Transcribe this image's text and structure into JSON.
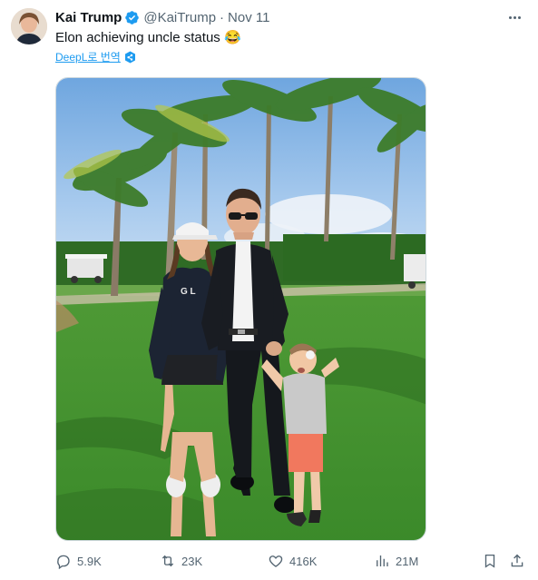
{
  "tweet": {
    "author_name": "Kai Trump",
    "handle": "@KaiTrump",
    "separator": "·",
    "time": "Nov 11",
    "text": "Elon achieving uncle status 😂",
    "translate_label": "DeepL로 번역",
    "actions": {
      "replies": "5.9K",
      "retweets": "23K",
      "likes": "416K",
      "views": "21M"
    }
  },
  "photo_shirt_text": "G  L",
  "colors": {
    "accent": "#1d9bf0",
    "text_secondary": "#536471",
    "verified": "#1d9bf0"
  },
  "icons": [
    "more-icon",
    "verified-badge-icon",
    "deepl-icon",
    "reply-icon",
    "retweet-icon",
    "like-icon",
    "views-icon",
    "bookmark-icon",
    "share-icon"
  ]
}
